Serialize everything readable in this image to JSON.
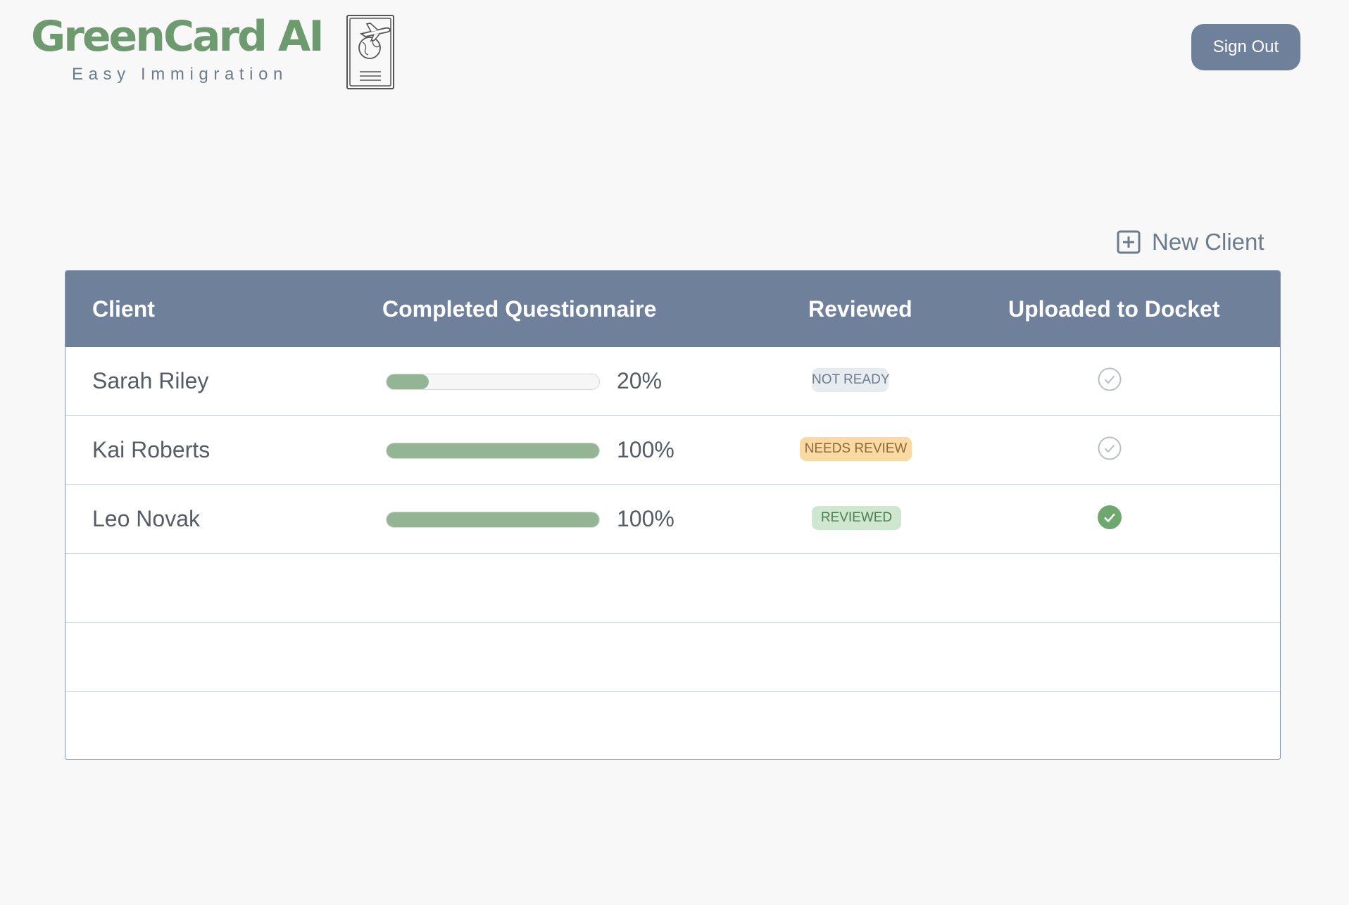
{
  "header": {
    "logo_title": "GreenCard AI",
    "logo_tagline": "Easy Immigration",
    "sign_out_label": "Sign Out"
  },
  "actions": {
    "new_client_label": "New Client"
  },
  "table": {
    "columns": [
      "Client",
      "Completed Questionnaire",
      "Reviewed",
      "Uploaded to Docket"
    ],
    "rows": [
      {
        "client": "Sarah Riley",
        "progress": 20,
        "progress_label": "20%",
        "reviewed": "NOT READY",
        "uploaded": false
      },
      {
        "client": "Kai Roberts",
        "progress": 100,
        "progress_label": "100%",
        "reviewed": "NEEDS REVIEW",
        "uploaded": false
      },
      {
        "client": "Leo Novak",
        "progress": 100,
        "progress_label": "100%",
        "reviewed": "REVIEWED",
        "uploaded": true
      }
    ]
  },
  "colors": {
    "brand_green": "#6e9a6f",
    "slate": "#6f809a",
    "progress_fill": "#93b593",
    "badge_not_ready_bg": "#e8ebef",
    "badge_needs_review_bg": "#fad9a2",
    "badge_reviewed_bg": "#cfe7cf",
    "uploaded_check": "#6ea86f"
  },
  "icons": {
    "logo": "passport-airplane-icon",
    "new_client": "plus-square-icon",
    "uploaded_done": "check-circle-filled-icon",
    "uploaded_pending": "check-circle-outline-icon"
  }
}
